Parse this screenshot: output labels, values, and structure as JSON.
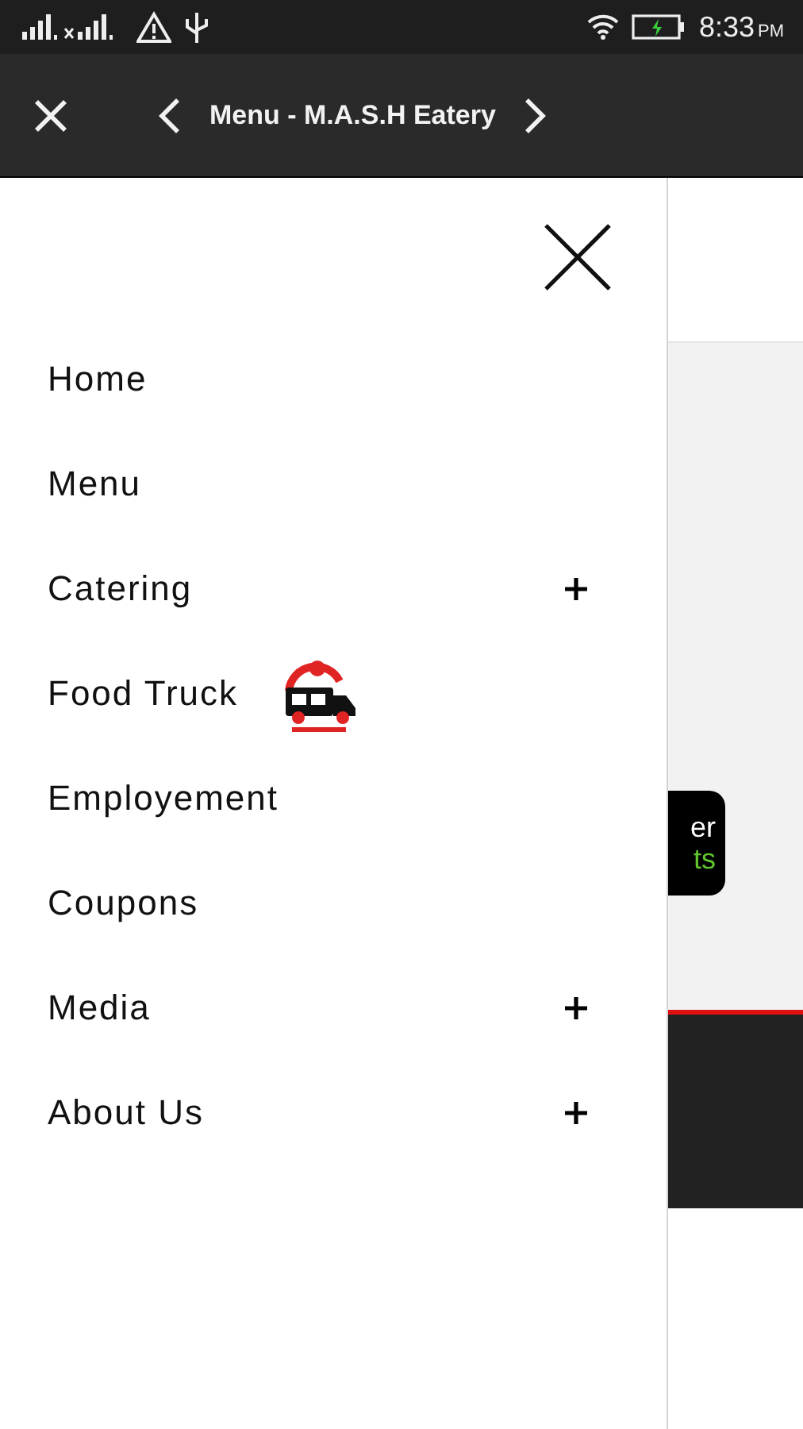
{
  "status_bar": {
    "time": "8:33",
    "period": "PM"
  },
  "header": {
    "title": "Menu - M.A.S.H Eatery"
  },
  "drawer": {
    "items": [
      {
        "label": "Home",
        "kind": "plain",
        "expandable": false
      },
      {
        "label": "Menu",
        "kind": "plain",
        "expandable": false
      },
      {
        "label": "Catering",
        "kind": "plain",
        "expandable": true
      },
      {
        "label": "Food Truck",
        "kind": "logo",
        "expandable": false
      },
      {
        "label": "Employement",
        "kind": "plain",
        "expandable": false
      },
      {
        "label": "Coupons",
        "kind": "plain",
        "expandable": false
      },
      {
        "label": "Media",
        "kind": "plain",
        "expandable": true
      },
      {
        "label": "About Us",
        "kind": "plain",
        "expandable": true
      }
    ]
  },
  "background_page": {
    "badge": {
      "line_1": "er",
      "line_2": "ts"
    }
  }
}
